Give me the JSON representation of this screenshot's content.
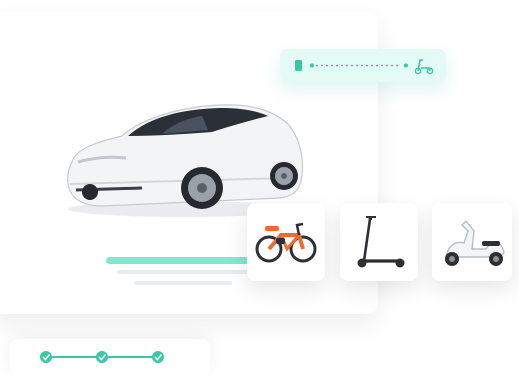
{
  "illustration": {
    "main_vehicle": "white-electric-car",
    "route_indicator": {
      "start_icon": "phone-icon",
      "end_icon": "scooter-icon",
      "accent": "#38c9a4"
    },
    "vehicle_options": [
      "ebike-icon",
      "kick-scooter-icon",
      "moped-icon"
    ],
    "progress_steps": {
      "total": 3,
      "completed": 3,
      "accent": "#38c9a4"
    },
    "colors": {
      "teal_bar": "#86e4cf",
      "pill_bg": "#e4faf4",
      "bike_accent": "#f26a2e"
    }
  }
}
